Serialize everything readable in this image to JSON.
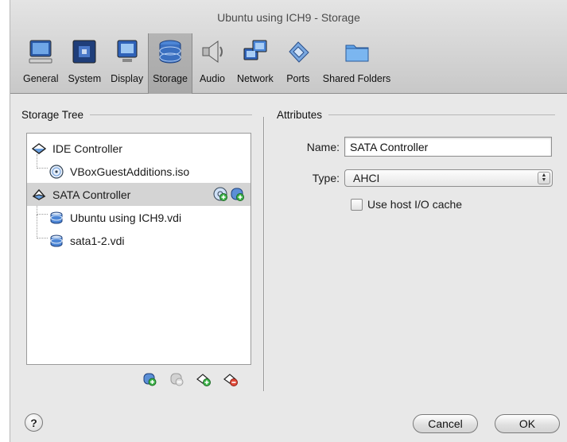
{
  "window": {
    "title": "Ubuntu using ICH9 - Storage"
  },
  "toolbar": {
    "items": [
      {
        "label": "General",
        "icon": "monitor-icon"
      },
      {
        "label": "System",
        "icon": "chip-icon"
      },
      {
        "label": "Display",
        "icon": "display-icon"
      },
      {
        "label": "Storage",
        "icon": "storage-icon",
        "active": true
      },
      {
        "label": "Audio",
        "icon": "speaker-icon"
      },
      {
        "label": "Network",
        "icon": "network-icon"
      },
      {
        "label": "Ports",
        "icon": "ports-icon"
      },
      {
        "label": "Shared Folders",
        "icon": "folder-icon"
      }
    ]
  },
  "storage_tree": {
    "heading": "Storage Tree",
    "items": [
      {
        "label": "IDE Controller",
        "type": "controller"
      },
      {
        "label": "VBoxGuestAdditions.iso",
        "type": "optical"
      },
      {
        "label": "SATA Controller",
        "type": "controller",
        "selected": true
      },
      {
        "label": "Ubuntu using ICH9.vdi",
        "type": "disk"
      },
      {
        "label": "sata1-2.vdi",
        "type": "disk"
      }
    ]
  },
  "attributes": {
    "heading": "Attributes",
    "name_label": "Name:",
    "name_value": "SATA Controller",
    "type_label": "Type:",
    "type_value": "AHCI",
    "host_cache_label": "Use host I/O cache",
    "host_cache_checked": false
  },
  "footer": {
    "help_label": "?",
    "cancel_label": "Cancel",
    "ok_label": "OK"
  }
}
